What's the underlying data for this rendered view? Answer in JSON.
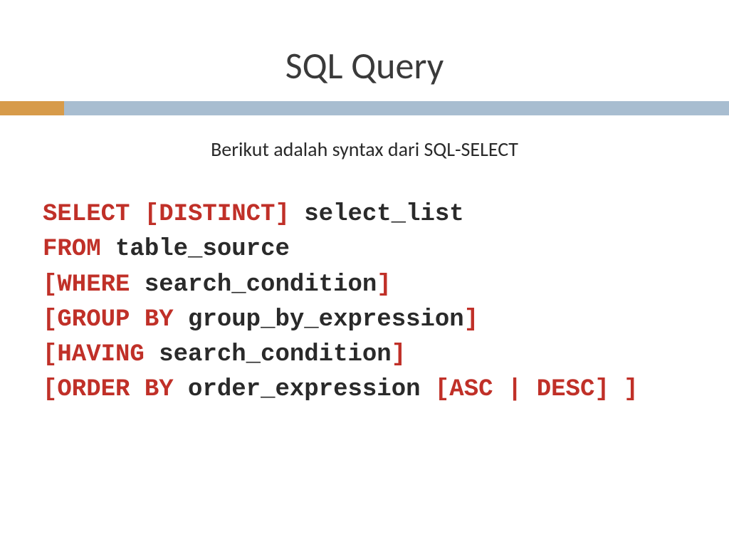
{
  "title": "SQL Query",
  "subtitle": "Berikut adalah syntax dari SQL-SELECT",
  "syntax": {
    "line1": {
      "kw1": "SELECT [DISTINCT] ",
      "nm1": "select_list"
    },
    "line2": {
      "kw1": "FROM ",
      "nm1": "table_source"
    },
    "line3": {
      "kw1": "[WHERE ",
      "nm1": "search_condition",
      "kw2": "]"
    },
    "line4": {
      "kw1": "[GROUP BY ",
      "nm1": "group_by_expression",
      "kw2": "]"
    },
    "line5": {
      "kw1": "[HAVING ",
      "nm1": "search_condition",
      "kw2": "]"
    },
    "line6": {
      "kw1": "[ORDER BY ",
      "nm1": "order_expression ",
      "kw2": "[ASC | DESC] ]"
    }
  }
}
